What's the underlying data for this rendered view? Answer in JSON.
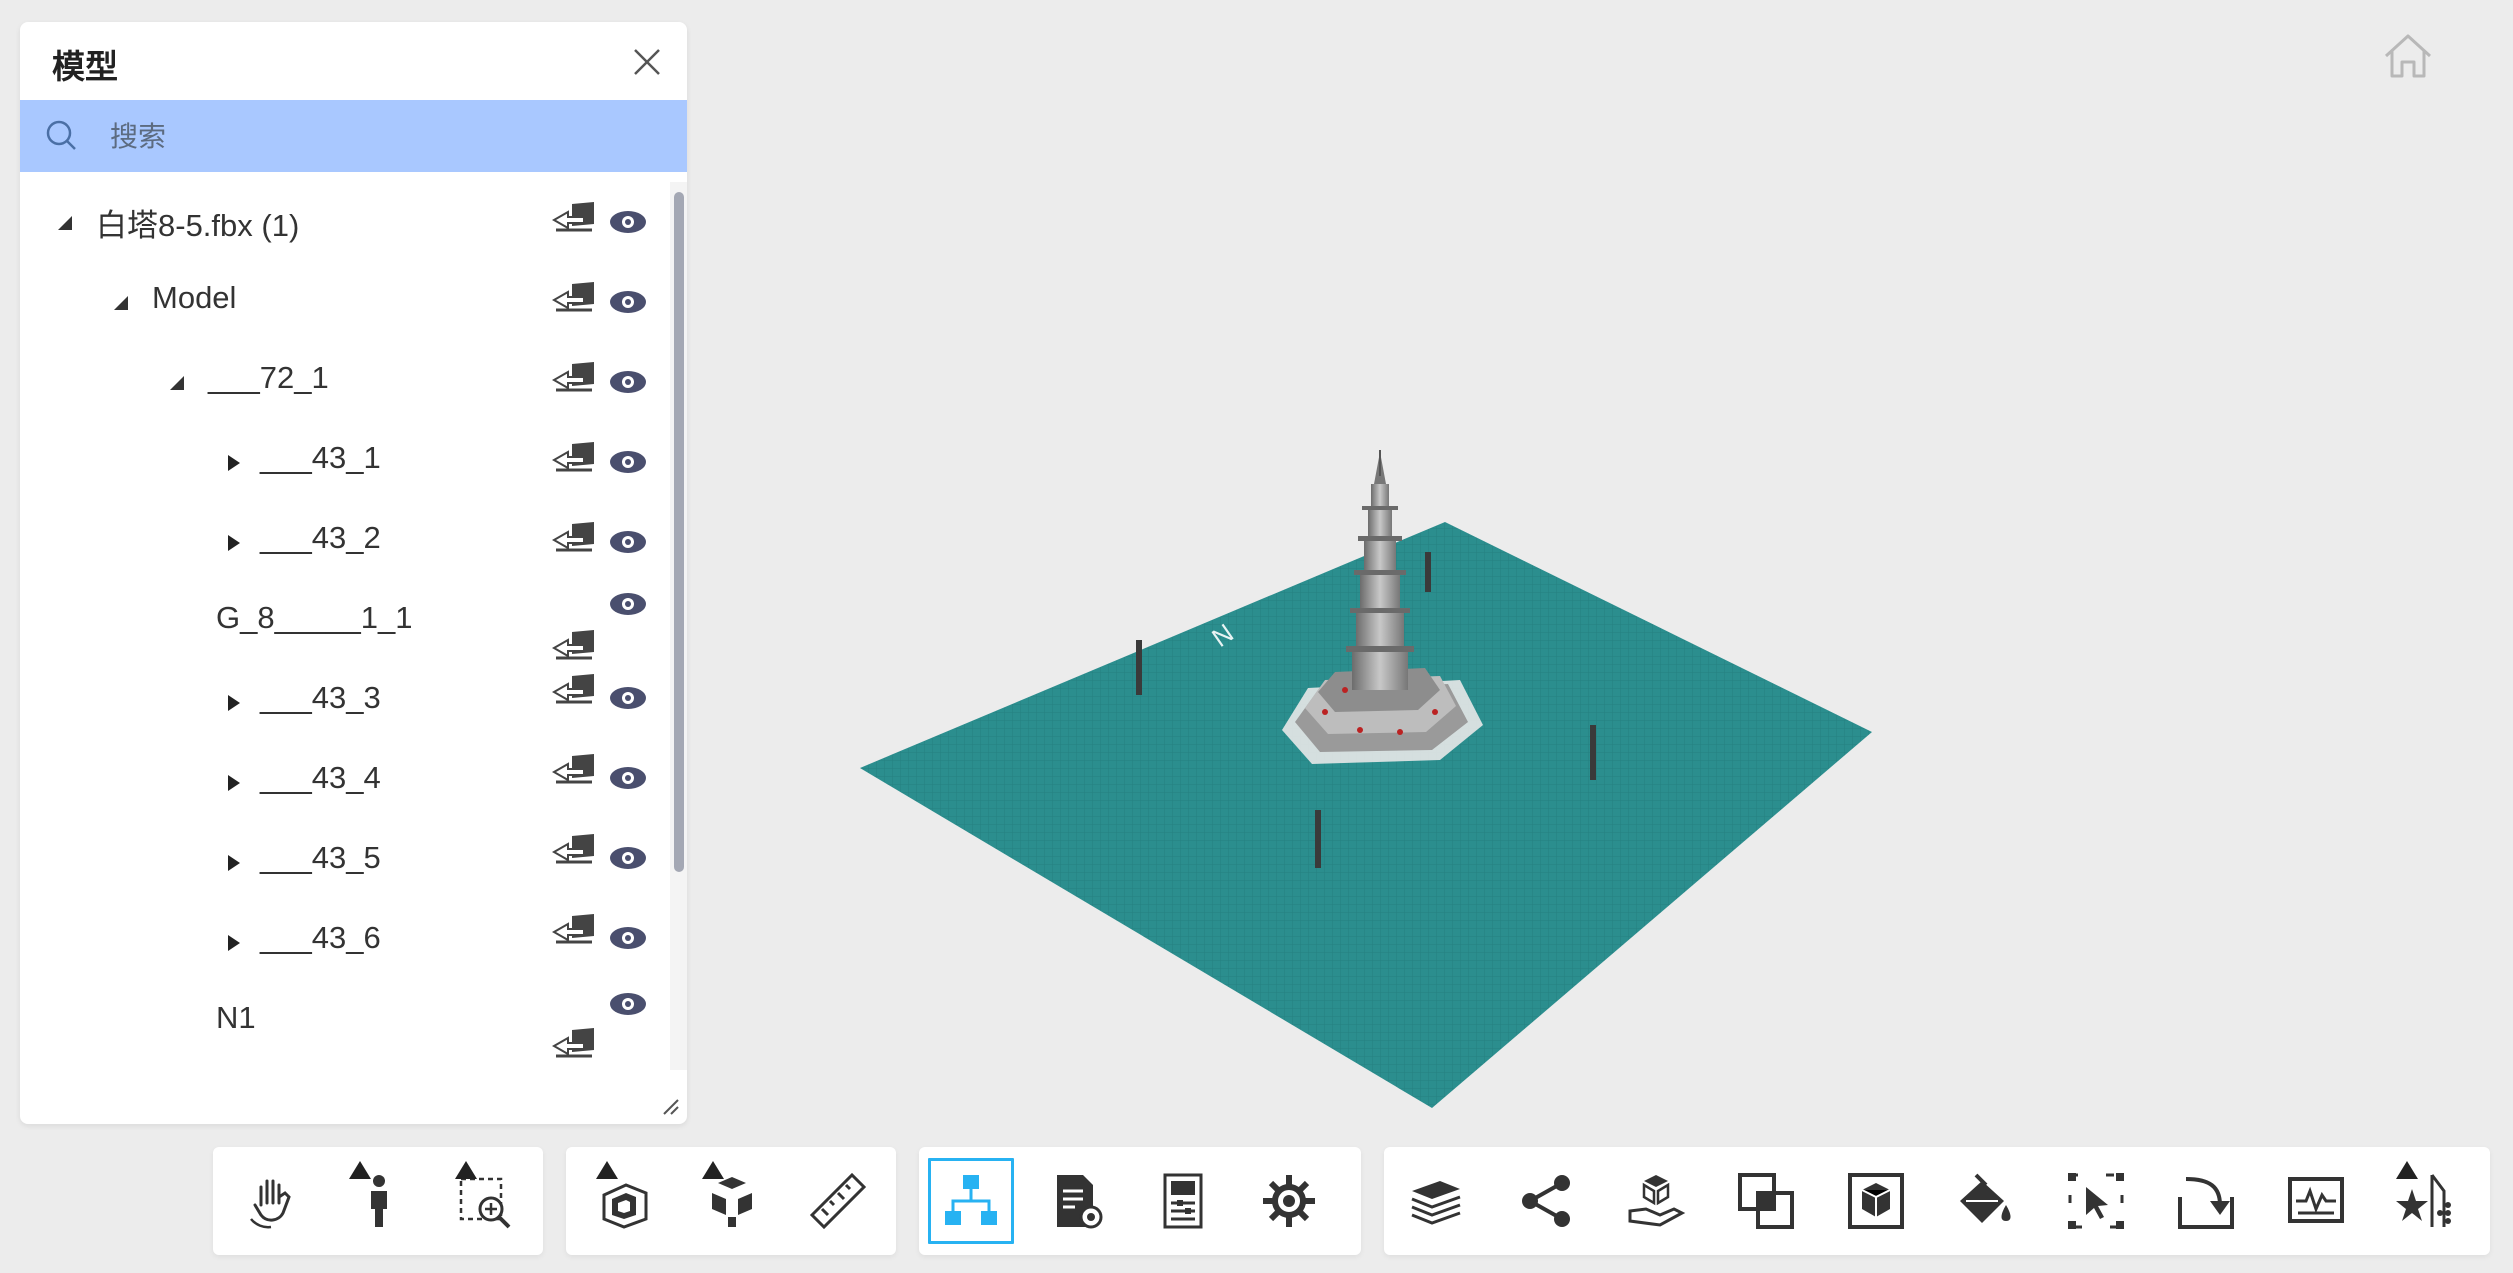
{
  "panel": {
    "title": "模型",
    "search_placeholder": "搜索",
    "search_value": ""
  },
  "tree": [
    {
      "label": "白塔8-5.fbx (1)",
      "expanded": true
    },
    {
      "label": "Model",
      "expanded": true
    },
    {
      "label": "___72_1",
      "expanded": true
    },
    {
      "label": "___43_1",
      "expanded": false
    },
    {
      "label": "___43_2",
      "expanded": false
    },
    {
      "label": "G_8_____1_1"
    },
    {
      "label": "___43_3",
      "expanded": false
    },
    {
      "label": "___43_4",
      "expanded": false
    },
    {
      "label": "___43_5",
      "expanded": false
    },
    {
      "label": "___43_6",
      "expanded": false
    },
    {
      "label": "N1"
    }
  ],
  "scene": {
    "compass_label": "N",
    "ground_color": "#2b8e8e"
  },
  "colors": {
    "accent": "#27b2f2",
    "search_bg": "#a9c8ff",
    "eye": "#4a4f6e"
  },
  "toolbars": [
    {
      "group": "navigation",
      "tools": [
        "pan-hand-icon",
        "walk-person-icon",
        "zoom-window-icon"
      ]
    },
    {
      "group": "model",
      "tools": [
        "section-box-icon",
        "explode-cubes-icon",
        "measure-ruler-icon"
      ]
    },
    {
      "group": "panels",
      "tools": [
        "model-tree-icon",
        "properties-doc-icon",
        "document-browser-icon",
        "settings-gear-icon"
      ],
      "active": "model-tree-icon"
    },
    {
      "group": "extensions",
      "tools": [
        "layers-stack-icon",
        "share-icon",
        "hand-box-icon",
        "overlap-squares-icon",
        "cube-frame-icon",
        "paint-bucket-icon",
        "selection-cursor-icon",
        "import-arrow-icon",
        "monitor-chart-icon",
        "star-effects-icon"
      ]
    }
  ]
}
